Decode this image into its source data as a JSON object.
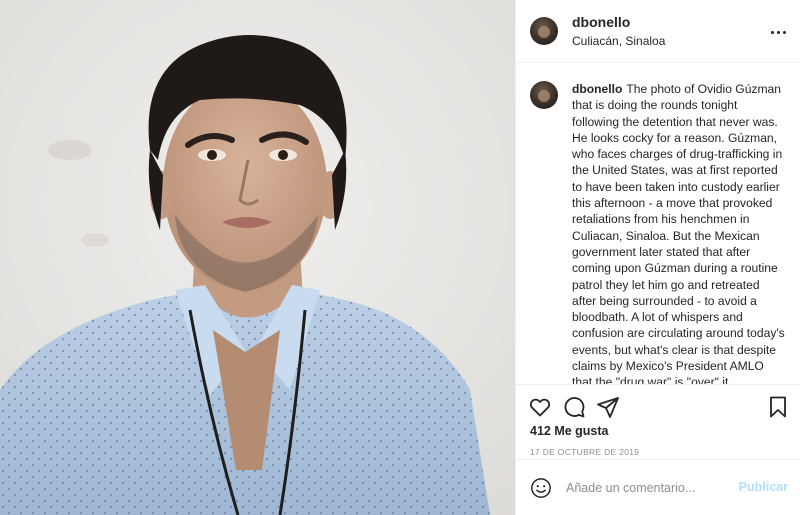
{
  "post": {
    "username": "dbonello",
    "location": "Culiacán, Sinaloa",
    "caption_user": "dbonello",
    "caption_text": "The photo of Ovidio Gúzman that is doing the rounds tonight following the detention that never was. He looks cocky for a reason. Gúzman, who faces charges of drug-trafficking in the United States, was at first reported to have been taken into custody earlier this afternoon - a move that provoked retaliations from his henchmen in Culiacan, Sinaloa. But the Mexican government later stated that after coming upon Gúzman during a routine patrol they let him go and retreated after being surrounded - to avoid a bloodbath. A lot of whispers and confusion are circulating around today's events, but what's clear is that despite claims by Mexico's President AMLO that the \"drug war\" is \"over\" it",
    "likes": "412 Me gusta",
    "date": "17 DE OCTUBRE DE 2019"
  },
  "actions": {
    "like_icon": "heart-icon",
    "comment_icon": "comment-icon",
    "share_icon": "share-icon",
    "save_icon": "bookmark-icon",
    "more_icon": "more-options-icon"
  },
  "comment": {
    "placeholder": "Añade un comentario...",
    "publish_label": "Publicar",
    "emoji_icon": "emoji-icon"
  },
  "colors": {
    "text": "#262626",
    "muted": "#8e8e8e",
    "publish_disabled": "#b2dffc",
    "divider": "#efefef"
  }
}
